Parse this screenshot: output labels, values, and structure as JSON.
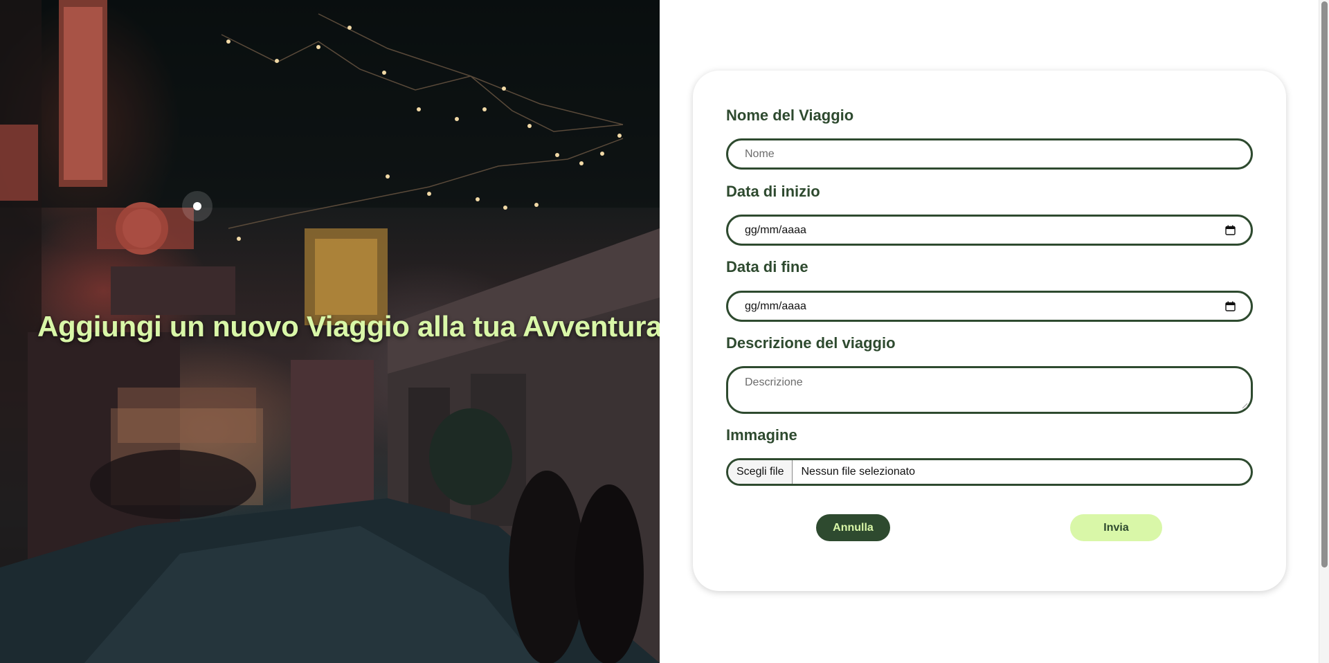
{
  "hero": {
    "title": "Aggiungi un nuovo Viaggio alla tua Avventura!"
  },
  "form": {
    "trip_name": {
      "label": "Nome del Viaggio",
      "placeholder": "Nome",
      "value": ""
    },
    "start_date": {
      "label": "Data di inizio",
      "display": "gg/mm/aaaa"
    },
    "end_date": {
      "label": "Data di fine",
      "display": "gg/mm/aaaa"
    },
    "description": {
      "label": "Descrizione del viaggio",
      "placeholder": "Descrizione",
      "value": ""
    },
    "image": {
      "label": "Immagine",
      "choose_label": "Scegli file",
      "status": "Nessun file selezionato"
    },
    "cancel_label": "Annulla",
    "submit_label": "Invia"
  },
  "colors": {
    "primary": "#2e4a2f",
    "accent": "#d9f7a8",
    "card_bg": "#ffffff"
  },
  "icons": [
    "calendar-icon",
    "resize-grip-icon"
  ]
}
